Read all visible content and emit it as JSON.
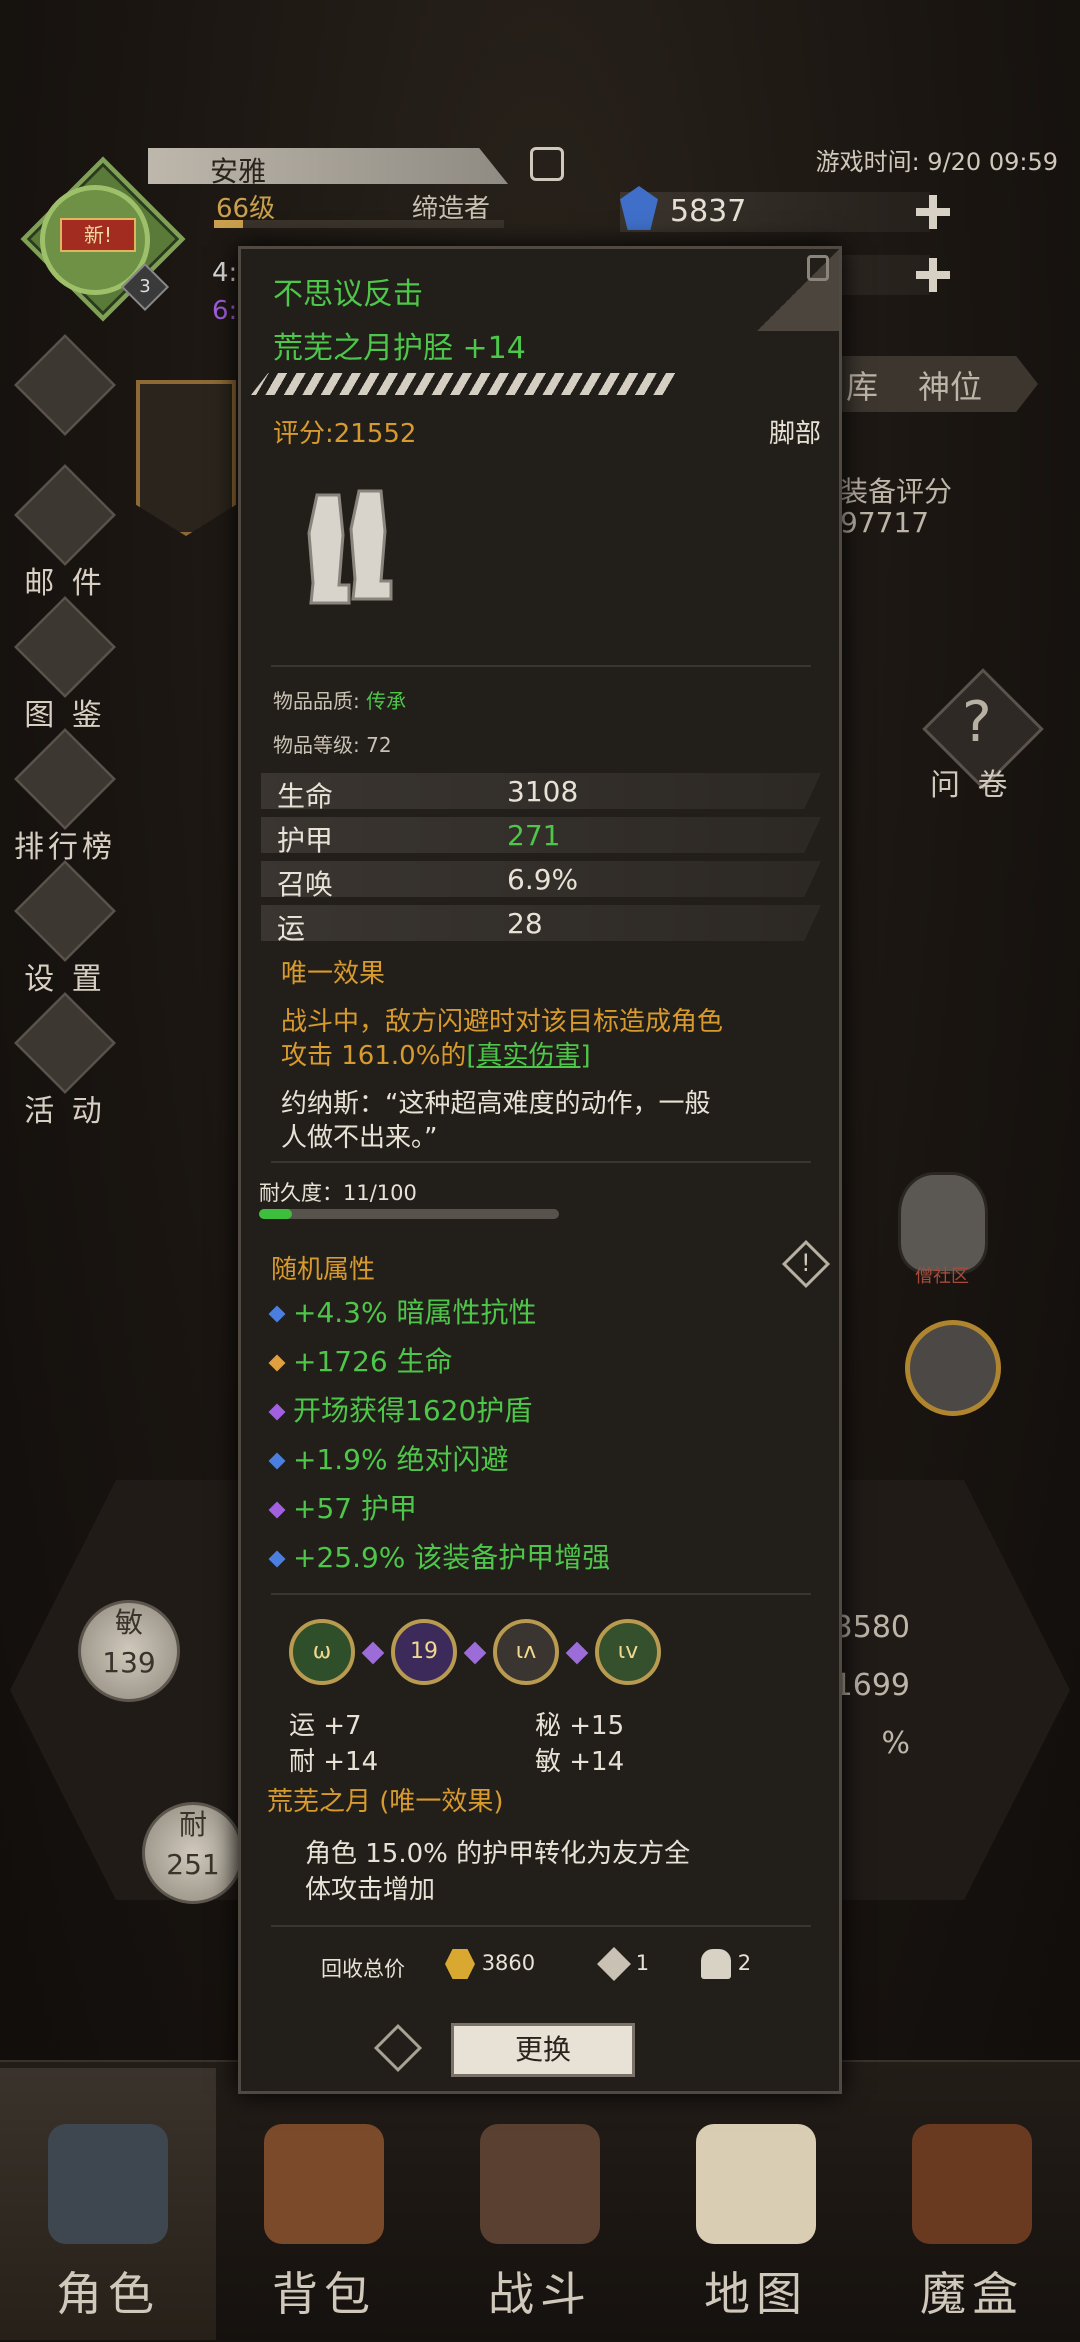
{
  "header": {
    "player_name": "安雅",
    "level": "66级",
    "title": "缔造者",
    "new_badge": "新!",
    "avatar_rank": "3",
    "partial_left_value": "4:",
    "partial_left_value2": "6:",
    "game_time": "游戏时间: 9/20 09:59",
    "gems": "5837"
  },
  "left_menu": [
    {
      "label": "邮 件",
      "icon": "mail-icon"
    },
    {
      "label": "图 鉴",
      "icon": "book-icon"
    },
    {
      "label": "排行榜",
      "icon": "ranking-icon"
    },
    {
      "label": "设 置",
      "icon": "gear-icon"
    },
    {
      "label": "活 动",
      "icon": "event-icon"
    }
  ],
  "right": {
    "tab_partial": "库",
    "tab_divine": "神位",
    "equip_score_label": "装备评分",
    "equip_score_value": "97717",
    "survey_label": "问 卷",
    "community_label": "僧社区",
    "num1": "3580",
    "num2": "1699",
    "num3": "%"
  },
  "center": {
    "orb1_label": "敏",
    "orb1_value": "139",
    "orb2_label": "耐",
    "orb2_value": "251"
  },
  "popup": {
    "prefix": "不思议反击",
    "item_name": "荒芜之月护胫 +14",
    "score": "评分:21552",
    "slot": "脚部",
    "quality_label": "物品品质: ",
    "quality_value": "传承",
    "item_level": "物品等级: 72",
    "stats": [
      {
        "name": "生命",
        "value": "3108",
        "color": "#e8e2d6"
      },
      {
        "name": "护甲",
        "value": "271",
        "color": "#4ec64a"
      },
      {
        "name": "召唤",
        "value": "6.9%",
        "color": "#e8e2d6"
      },
      {
        "name": "运",
        "value": "28",
        "color": "#e8e2d6"
      }
    ],
    "unique_title": "唯一效果",
    "unique_text_a": "战斗中，敌方闪避时对该目标造成角色",
    "unique_text_b": "攻击 161.0%的",
    "unique_link": "[真实伤害]",
    "quote_a": "约纳斯：“这种超高难度的动作，一般",
    "quote_b": "人做不出来。”",
    "durability": "耐久度：11/100",
    "durability_fraction": 0.11,
    "random_title": "随机属性",
    "random_attrs": [
      {
        "text": "+4.3% 暗属性抗性",
        "dot": "#4a7fe0"
      },
      {
        "text": "+1726 生命",
        "dot": "#e0a040"
      },
      {
        "text": "开场获得1620护盾",
        "dot": "#a060e0"
      },
      {
        "text": "+1.9% 绝对闪避",
        "dot": "#4a7fe0"
      },
      {
        "text": "+57 护甲",
        "dot": "#a060e0"
      },
      {
        "text": "+25.9% 该装备护甲增强",
        "dot": "#4a7fe0"
      }
    ],
    "gems": [
      {
        "glyph": "ω",
        "color": "#5a8a3a"
      },
      {
        "glyph": "19",
        "color": "#5a3a8a"
      },
      {
        "glyph": "ɩʌ",
        "color": "#4a4540"
      },
      {
        "glyph": "ɩv",
        "color": "#4a6a3a"
      }
    ],
    "gem_stats": [
      "运 +7",
      "秘 +15",
      "耐 +14",
      "敏 +14"
    ],
    "set_title": "荒芜之月 (唯一效果)",
    "set_text_a": "角色 15.0% 的护甲转化为友方全",
    "set_text_b": "体攻击增加",
    "recycle_label": "回收总价",
    "recycle_gold": "3860",
    "recycle_silver": "1",
    "recycle_rune": "2",
    "replace_btn": "更换"
  },
  "nav": [
    {
      "label": "角色",
      "icon": "helmet-icon"
    },
    {
      "label": "背包",
      "icon": "backpack-icon"
    },
    {
      "label": "战斗",
      "icon": "sword-shield-icon"
    },
    {
      "label": "地图",
      "icon": "scroll-map-icon"
    },
    {
      "label": "魔盒",
      "icon": "magic-box-icon"
    }
  ]
}
